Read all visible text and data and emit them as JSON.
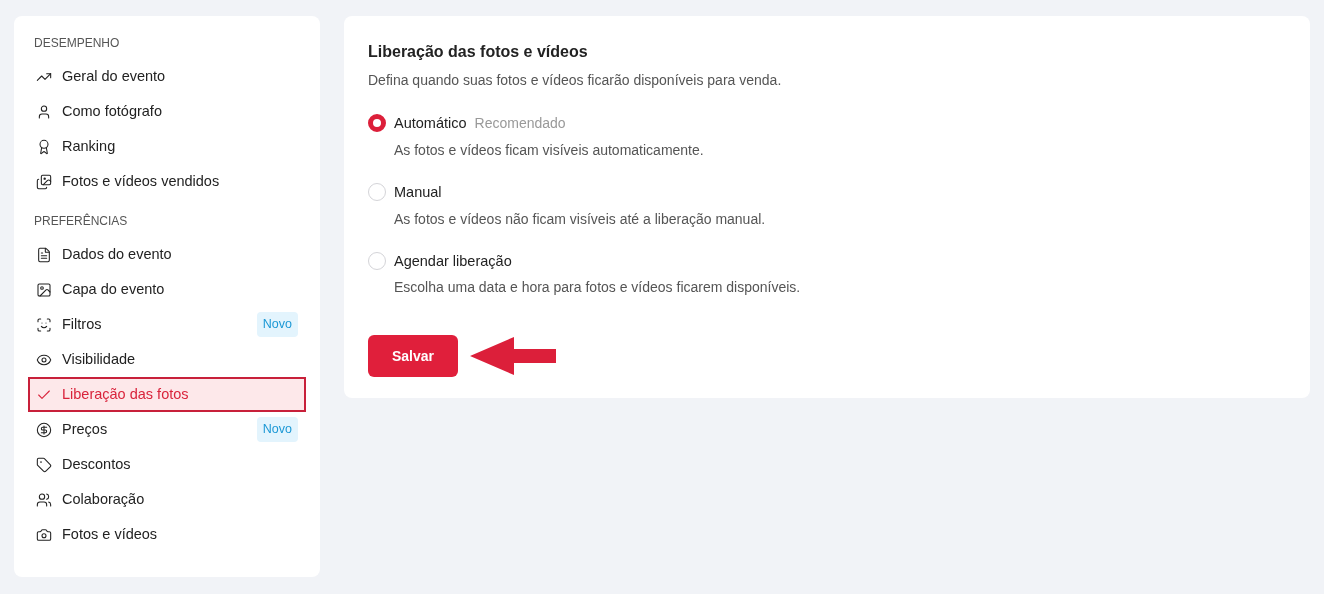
{
  "sidebar": {
    "sections": [
      {
        "heading": "DESEMPENHO",
        "items": [
          {
            "label": "Geral do evento",
            "selected": false
          },
          {
            "label": "Como fotógrafo",
            "selected": false
          },
          {
            "label": "Ranking",
            "selected": false
          },
          {
            "label": "Fotos e vídeos vendidos",
            "selected": false
          }
        ]
      },
      {
        "heading": "PREFERÊNCIAS",
        "items": [
          {
            "label": "Dados do evento",
            "selected": false
          },
          {
            "label": "Capa do evento",
            "selected": false
          },
          {
            "label": "Filtros",
            "selected": false,
            "badge": "Novo"
          },
          {
            "label": "Visibilidade",
            "selected": false
          },
          {
            "label": "Liberação das fotos",
            "selected": true
          },
          {
            "label": "Preços",
            "selected": false,
            "badge": "Novo"
          },
          {
            "label": "Descontos",
            "selected": false
          },
          {
            "label": "Colaboração",
            "selected": false
          },
          {
            "label": "Fotos e vídeos",
            "selected": false
          }
        ]
      }
    ]
  },
  "panel": {
    "title": "Liberação das fotos e vídeos",
    "description": "Defina quando suas fotos e vídeos ficarão disponíveis para venda.",
    "options": [
      {
        "label": "Automático",
        "hint": "Recomendado",
        "description": "As fotos e vídeos ficam visíveis automaticamente.",
        "selected": true
      },
      {
        "label": "Manual",
        "description": "As fotos e vídeos não ficam visíveis até a liberação manual.",
        "selected": false
      },
      {
        "label": "Agendar liberação",
        "description": "Escolha uma data e hora para fotos e vídeos ficarem disponíveis.",
        "selected": false
      }
    ],
    "save_button": "Salvar"
  }
}
